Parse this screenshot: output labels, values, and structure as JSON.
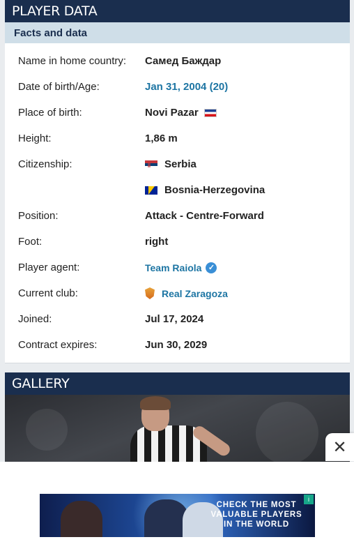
{
  "player_data": {
    "title": "PLAYER DATA",
    "subtitle": "Facts and data",
    "rows": [
      {
        "label": "Name in home country:",
        "value": "Самед Баждар"
      },
      {
        "label": "Date of birth/Age:",
        "value": "Jan 31, 2004 (20)"
      },
      {
        "label": "Place of birth:",
        "value": "Novi Pazar",
        "icon": "serbia-and-montenegro-flag-icon"
      },
      {
        "label": "Height:",
        "value": "1,86 m"
      },
      {
        "label": "Citizenship:",
        "value": "Serbia",
        "icon": "serbia-flag-icon"
      },
      {
        "label": "",
        "value": "Bosnia-Herzegovina",
        "icon": "bosnia-flag-icon"
      },
      {
        "label": "Position:",
        "value": "Attack - Centre-Forward"
      },
      {
        "label": "Foot:",
        "value": "right"
      },
      {
        "label": "Player agent:",
        "value": "Team Raiola",
        "icon": "verified-check-icon"
      },
      {
        "label": "Current club:",
        "value": "Real Zaragoza",
        "icon": "club-crest-icon"
      },
      {
        "label": "Joined:",
        "value": "Jul 17, 2024"
      },
      {
        "label": "Contract expires:",
        "value": "Jun 30, 2029"
      }
    ]
  },
  "gallery": {
    "title": "GALLERY"
  },
  "ad": {
    "close_symbol": "✕",
    "headline": "CHECK THE MOST VALUABLE PLAYERS IN THE WORLD",
    "badge": "i"
  },
  "colors": {
    "header_bg": "#1a2e4e",
    "subheader_bg": "#cfdee8",
    "link": "#1d75a3"
  }
}
